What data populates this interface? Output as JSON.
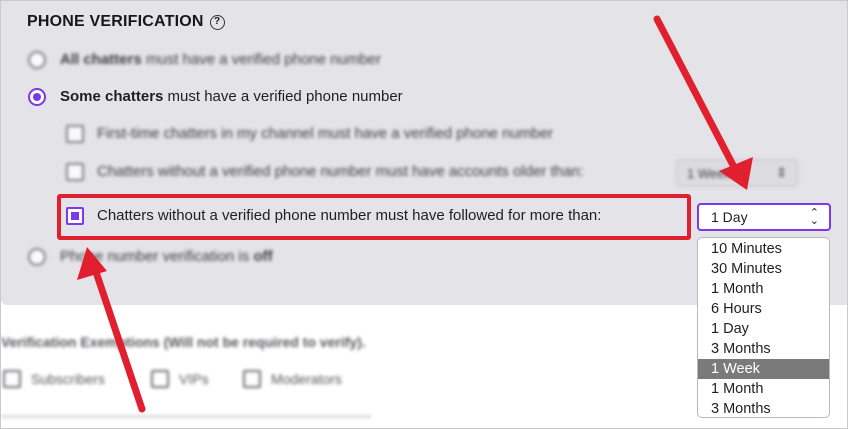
{
  "section": {
    "title": "PHONE VERIFICATION",
    "help_icon": "?"
  },
  "options": {
    "all_bold": "All chatters",
    "all_rest": " must have a verified phone number",
    "some_bold": "Some chatters",
    "some_rest": " must have a verified phone number",
    "first_time": "First-time chatters in my channel must have a verified phone number",
    "older_than": "Chatters without a verified phone number must have accounts older than:",
    "older_value": "1 Week",
    "followed": "Chatters without a verified phone number must have followed for more than:",
    "off_text": "Phone number verification is ",
    "off_bold": "off"
  },
  "select": {
    "value": "1 Day",
    "arrows": "⌃⌄"
  },
  "dropdown": {
    "items": [
      "10 Minutes",
      "30 Minutes",
      "1 Month",
      "6 Hours",
      "1 Day",
      "3 Months",
      "1 Week",
      "1 Month",
      "3 Months"
    ],
    "selected_label": "1 Week"
  },
  "exemptions": {
    "title": "Verification Exemptions (Will not be required to verify).",
    "items": [
      "Subscribers",
      "VIPs",
      "Moderators"
    ]
  },
  "colors": {
    "accent": "#7b39e8",
    "annotation": "#e0202e",
    "panel": "#e4e3e8"
  }
}
